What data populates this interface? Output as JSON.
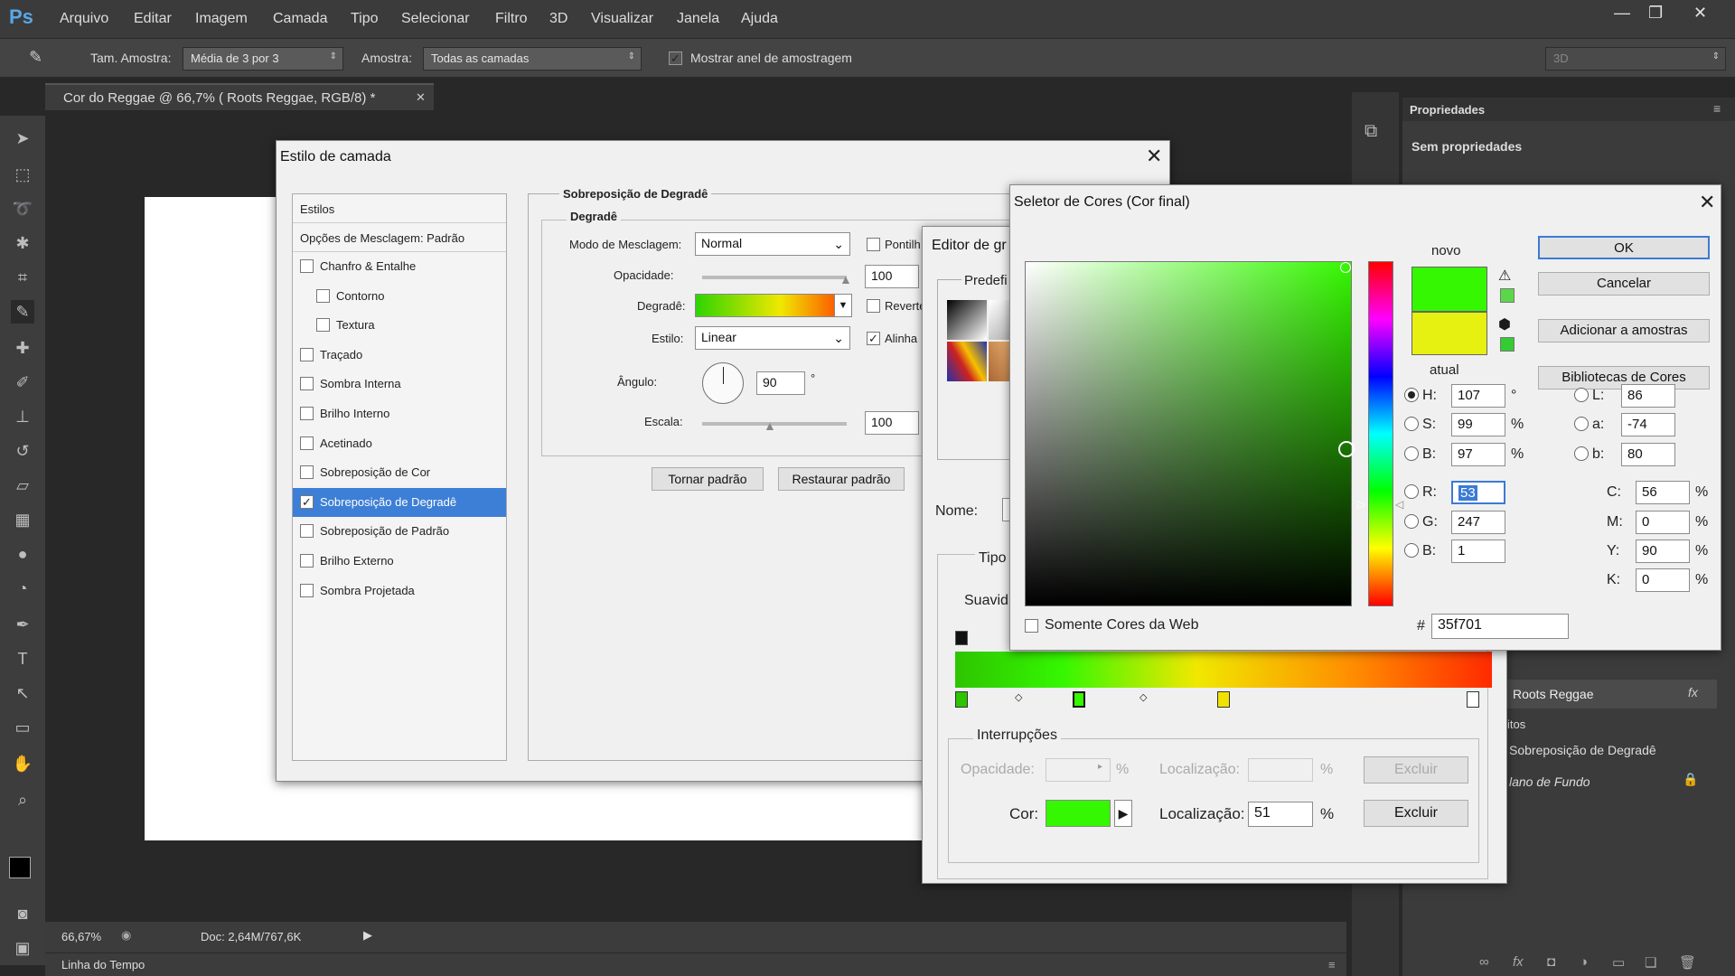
{
  "app": {
    "logo": "Ps",
    "menu": [
      "Arquivo",
      "Editar",
      "Imagem",
      "Camada",
      "Tipo",
      "Selecionar",
      "Filtro",
      "3D",
      "Visualizar",
      "Janela",
      "Ajuda"
    ]
  },
  "options": {
    "sample_size_label": "Tam. Amostra:",
    "sample_size_value": "Média de 3 por 3",
    "sample_label": "Amostra:",
    "sample_value": "Todas as camadas",
    "show_ring_label": "Mostrar anel de amostragem",
    "mode_3d": "3D"
  },
  "document": {
    "tab_title": "Cor do Reggae @ 66,7% (   Roots Reggae, RGB/8) *",
    "zoom": "66,67%",
    "doc_info": "Doc: 2,64M/767,6K"
  },
  "timeline": {
    "label": "Linha do Tempo"
  },
  "properties": {
    "tab": "Propriedades",
    "empty": "Sem propriedades"
  },
  "layers": {
    "roots": "Roots Reggae",
    "effects": "itos",
    "gradient_overlay": "Sobreposição de Degradê",
    "background": "lano de Fundo"
  },
  "layer_style": {
    "title": "Estilo de camada",
    "styles_header": "Estilos",
    "blend_options": "Opções de Mesclagem: Padrão",
    "items": [
      {
        "label": "Chanfro & Entalhe",
        "checked": false,
        "indent": false
      },
      {
        "label": "Contorno",
        "checked": false,
        "indent": true
      },
      {
        "label": "Textura",
        "checked": false,
        "indent": true
      },
      {
        "label": "Traçado",
        "checked": false,
        "indent": false
      },
      {
        "label": "Sombra Interna",
        "checked": false,
        "indent": false
      },
      {
        "label": "Brilho Interno",
        "checked": false,
        "indent": false
      },
      {
        "label": "Acetinado",
        "checked": false,
        "indent": false
      },
      {
        "label": "Sobreposição de Cor",
        "checked": false,
        "indent": false
      },
      {
        "label": "Sobreposição de Degradê",
        "checked": true,
        "indent": false,
        "selected": true
      },
      {
        "label": "Sobreposição de Padrão",
        "checked": false,
        "indent": false
      },
      {
        "label": "Brilho Externo",
        "checked": false,
        "indent": false
      },
      {
        "label": "Sombra Projetada",
        "checked": false,
        "indent": false
      }
    ],
    "section_title": "Sobreposição de Degradê",
    "sub_title": "Degradê",
    "blend_mode_label": "Modo de Mesclagem:",
    "blend_mode": "Normal",
    "dither_label": "Pontilh",
    "opacity_label": "Opacidade:",
    "opacity": "100",
    "gradient_label": "Degradê:",
    "reverse_label": "Reverte",
    "style_label": "Estilo:",
    "style": "Linear",
    "align_label": "Alinha",
    "angle_label": "Ângulo:",
    "angle": "90",
    "deg": "°",
    "scale_label": "Escala:",
    "scale": "100",
    "make_default": "Tornar padrão",
    "reset_default": "Restaurar padrão"
  },
  "gradient_editor": {
    "title": "Editor de gr",
    "presets": "Predefi",
    "name_label": "Nome:",
    "type_label": "Tipo",
    "smooth_label": "Suavid",
    "stops_legend": "Interrupções",
    "opacity_label": "Opacidade:",
    "pct": "%",
    "location_label": "Localização:",
    "location": "51",
    "delete": "Excluir",
    "color_label": "Cor:"
  },
  "color_picker": {
    "title": "Seletor de Cores (Cor final)",
    "new": "novo",
    "current": "atual",
    "ok": "OK",
    "cancel": "Cancelar",
    "add_swatch": "Adicionar a amostras",
    "libraries": "Bibliotecas de Cores",
    "web_only": "Somente Cores da Web",
    "hash": "#",
    "hex": "35f701",
    "fields": {
      "H": {
        "label": "H:",
        "value": "107",
        "unit": "°"
      },
      "S": {
        "label": "S:",
        "value": "99",
        "unit": "%"
      },
      "B": {
        "label": "B:",
        "value": "97",
        "unit": "%"
      },
      "R": {
        "label": "R:",
        "value": "53"
      },
      "G": {
        "label": "G:",
        "value": "247"
      },
      "Bl": {
        "label": "B:",
        "value": "1"
      },
      "L": {
        "label": "L:",
        "value": "86"
      },
      "a": {
        "label": "a:",
        "value": "-74"
      },
      "b": {
        "label": "b:",
        "value": "80"
      },
      "C": {
        "label": "C:",
        "value": "56",
        "unit": "%"
      },
      "M": {
        "label": "M:",
        "value": "0",
        "unit": "%"
      },
      "Y": {
        "label": "Y:",
        "value": "90",
        "unit": "%"
      },
      "K": {
        "label": "K:",
        "value": "0",
        "unit": "%"
      }
    }
  },
  "colors": {
    "new": "#35f701",
    "current": "#e6f011",
    "field_hue": "#35f701"
  }
}
